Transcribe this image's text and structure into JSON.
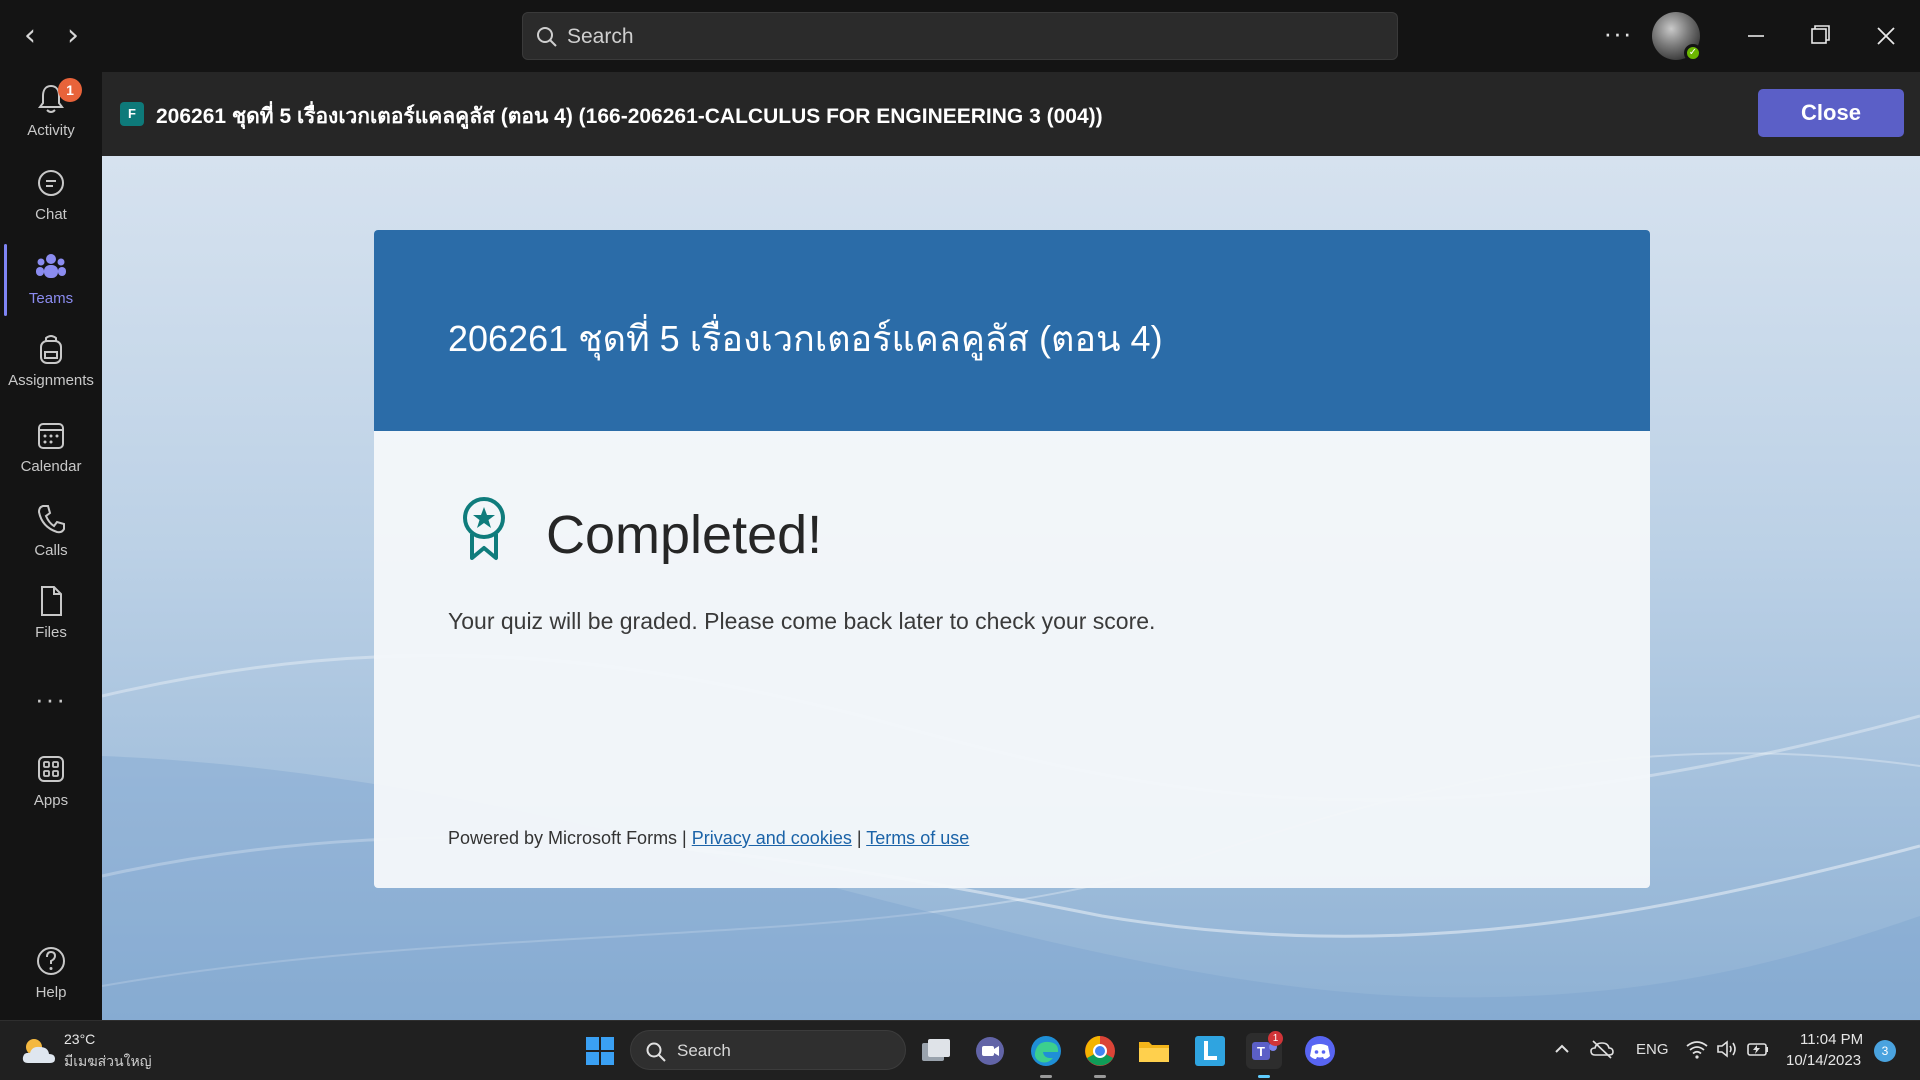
{
  "titlebar": {
    "search_placeholder": "Search",
    "back_glyph": "‹",
    "forward_glyph": "›",
    "more_glyph": "···"
  },
  "rail": {
    "items": [
      {
        "label": "Activity",
        "icon": "bell-icon",
        "badge": "1"
      },
      {
        "label": "Chat",
        "icon": "chat-icon"
      },
      {
        "label": "Teams",
        "icon": "teams-icon",
        "active": true
      },
      {
        "label": "Assignments",
        "icon": "backpack-icon"
      },
      {
        "label": "Calendar",
        "icon": "calendar-icon"
      },
      {
        "label": "Calls",
        "icon": "phone-icon"
      },
      {
        "label": "Files",
        "icon": "file-icon"
      },
      {
        "label": "Apps",
        "icon": "apps-icon"
      },
      {
        "label": "Help",
        "icon": "help-icon"
      }
    ],
    "more_glyph": "···"
  },
  "header": {
    "title": "206261 ชุดที่ 5 เรื่องเวกเตอร์แคลคูลัส (ตอน 4) (166-206261-CALCULUS FOR ENGINEERING 3 (004))",
    "close_label": "Close",
    "forms_icon_letter": "F",
    "accent": "#5b5fc7"
  },
  "form": {
    "title": "206261 ชุดที่ 5 เรื่องเวกเตอร์แคลคูลัส (ตอน 4)",
    "completed": "Completed!",
    "message": "Your quiz will be graded. Please come back later to check your score.",
    "footer_prefix": "Powered by Microsoft Forms | ",
    "privacy_link": "Privacy and cookies",
    "separator": " | ",
    "terms_link": "Terms of use",
    "header_color": "#2b6ca8"
  },
  "taskbar": {
    "temperature": "23°C",
    "weather": "มีเมฆส่วนใหญ่",
    "search_placeholder": "Search",
    "language": "ENG",
    "time": "11:04 PM",
    "date": "10/14/2023",
    "notifications": "3",
    "teams_badge": "1"
  }
}
